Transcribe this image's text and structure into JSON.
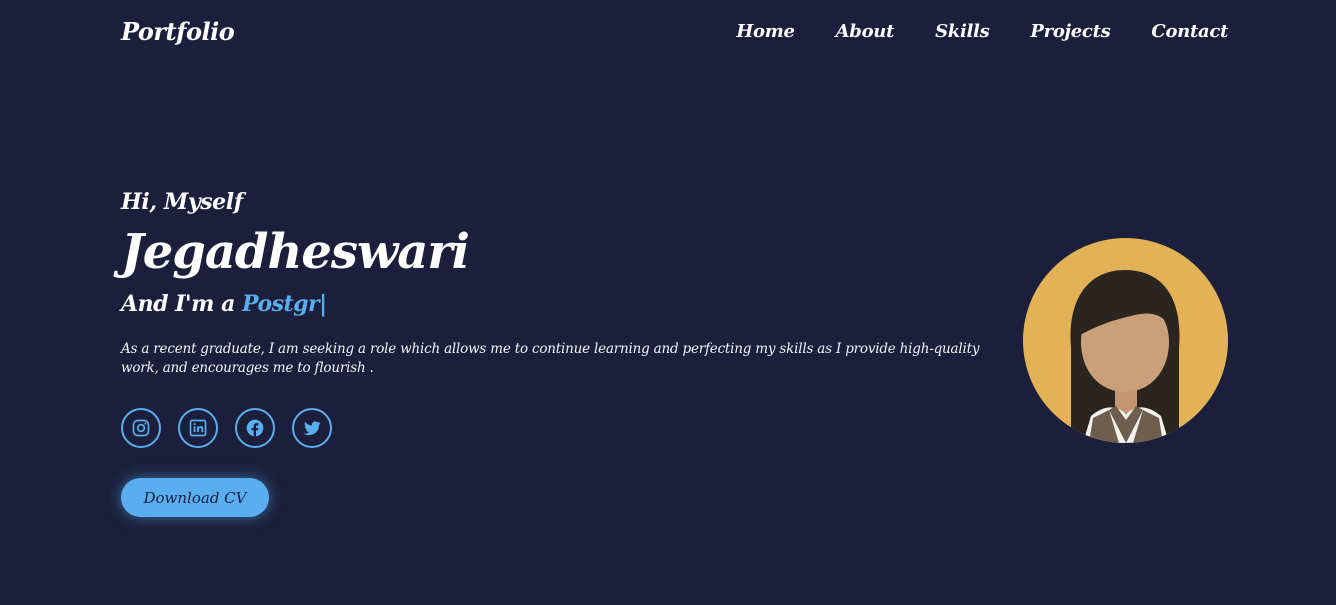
{
  "header": {
    "brand": "Portfolio",
    "nav": [
      "Home",
      "About",
      "Skills",
      "Projects",
      "Contact"
    ]
  },
  "hero": {
    "greeting": "Hi, Myself",
    "name": "Jegadheswari",
    "role_prefix": "And I'm a",
    "role_typed": "Postgr",
    "role_caret": "|",
    "intro": "As a recent graduate, I am seeking a role which allows me to continue learning and perfecting my skills as I provide high-quality work, and encourages me to flourish .",
    "socials": [
      "instagram-icon",
      "linkedin-icon",
      "facebook-icon",
      "twitter-icon"
    ],
    "cv_button": "Download CV"
  },
  "colors": {
    "background": "#1b1f3b",
    "accent": "#5aaef0",
    "avatar_bg": "#e3b257"
  }
}
